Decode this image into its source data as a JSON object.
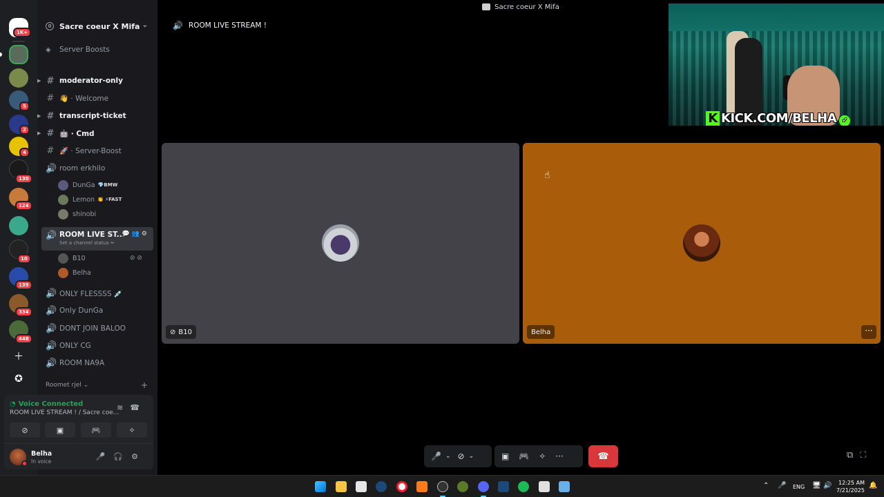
{
  "window": {
    "title": "Sacre coeur X Mifa"
  },
  "server_rail": {
    "badges": [
      "1K+",
      "5",
      "2",
      "4",
      "130",
      "124",
      "10",
      "139",
      "334",
      "448"
    ]
  },
  "sidebar": {
    "guild_name": "Sacre coeur X Mifa",
    "boosts_label": "Server Boosts",
    "channels": [
      {
        "name": "moderator-only",
        "type": "text",
        "bold": true
      },
      {
        "name": "👋 · Welcome",
        "type": "text",
        "bold": false
      },
      {
        "name": "transcript-ticket",
        "type": "text",
        "bold": true
      },
      {
        "name": "🤖 · Cmd",
        "type": "text",
        "bold": true
      },
      {
        "name": "🚀 · Server-Boost",
        "type": "text",
        "bold": false
      },
      {
        "name": "room erkhilo",
        "type": "voice",
        "bold": false
      }
    ],
    "erkhilo_members": [
      {
        "name": "DunGa",
        "tag": "💎BMW"
      },
      {
        "name": "Lemon",
        "tag": "👏 ⚡FAST"
      },
      {
        "name": "shinobi",
        "tag": ""
      }
    ],
    "active_channel": {
      "name": "ROOM LIVE ST...",
      "status_placeholder": "Set a channel status ✏"
    },
    "active_members": [
      {
        "name": "B10"
      },
      {
        "name": "Belha"
      }
    ],
    "more_channels": [
      "ONLY FLESSSS 💉",
      "Only DunGa",
      "DONT JOIN BALOO",
      "ONLY CG",
      "ROOM NA9A"
    ],
    "category": "Roomet rjel ⌄"
  },
  "voice_panel": {
    "status": "Voice Connected",
    "channel": "ROOM LIVE STREAM ! / Sacre coe...",
    "user_name": "Belha",
    "user_status": "In voice"
  },
  "main": {
    "room_title": "ROOM LIVE STREAM !",
    "tiles": [
      {
        "name": "B10",
        "color": "#424248"
      },
      {
        "name": "Belha",
        "color": "#a95c09"
      }
    ]
  },
  "stream_overlay": {
    "kick_text": "KICK.COM/BELHA"
  },
  "taskbar": {
    "lang": "ENG",
    "time": "12:25 AM",
    "date": "7/21/2025"
  },
  "colors": {
    "accent_green": "#23a559",
    "hangup_red": "#da373c",
    "kick_green": "#53fc18"
  }
}
